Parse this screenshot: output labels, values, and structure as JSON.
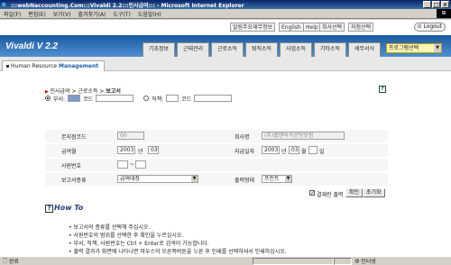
{
  "window": {
    "title": ":::webNaccounting.Com:::Vivaldi 2.2:::인사급여::: - Microsoft Internet Explorer",
    "minimize": "_",
    "maximize": "□",
    "close": "×"
  },
  "menu": [
    "파일(F)",
    "편집(E)",
    "보기(V)",
    "즐겨찾기(A)",
    "도구(T)",
    "도움말(H)"
  ],
  "topbar": {
    "links": [
      "알림주요재무정보",
      "English",
      "Help",
      "회사선택",
      "지점선택"
    ],
    "logout": "Logout"
  },
  "banner": {
    "logo": "Vivaldi  V 2.2",
    "tabs": [
      "기초정보",
      "근태관리",
      "근로소득",
      "퇴직소득",
      "사업소득",
      "기타소득",
      "세무서식"
    ],
    "program_select": "프로그램선택"
  },
  "module": {
    "label_plain": "Human Resource ",
    "label_bold": "Management"
  },
  "breadcrumb": {
    "items": [
      "인사급여",
      "근로소득"
    ],
    "current": "보고서"
  },
  "filter": {
    "dept_label": "부서:",
    "code_label": "코드",
    "rank_label": "직책:",
    "code_label2": "코드"
  },
  "form": {
    "fields": [
      {
        "label": "본지점코드",
        "value": "00"
      },
      {
        "label": "회사명",
        "value": "(주)웹앤어카운팅닷컴"
      },
      {
        "label": "급여월",
        "year": "2003",
        "year_unit": "년",
        "month": "03"
      },
      {
        "label": "지급일자",
        "year": "2003",
        "year_unit": "년",
        "month": "03",
        "month_unit": "월",
        "day_unit": "일"
      },
      {
        "label": "사원번호",
        "sep": "~"
      },
      {
        "label": "보고서종류",
        "value": "급여대장"
      },
      {
        "label": "출력형태",
        "value": "프린트"
      }
    ],
    "preview_label": "결재란 출력",
    "confirm_button": "확인",
    "reset_button": "초기화"
  },
  "howto": {
    "title": "How To",
    "items": [
      "보고서의 종류를 선택해 주십시오.",
      "사원번호의 범위를 선택한 후 확인을 누르십시오.",
      "부서, 직책, 사원번호는 Ctrl + Enter로 검색이 가능합니다.",
      "출력 결과가 화면에 나타나면 마우스의 오른쪽버튼을 누른 후 인쇄를 선택하셔서 인쇄하십시오."
    ]
  },
  "status": {
    "done": "완료",
    "zone": "인터넷"
  }
}
